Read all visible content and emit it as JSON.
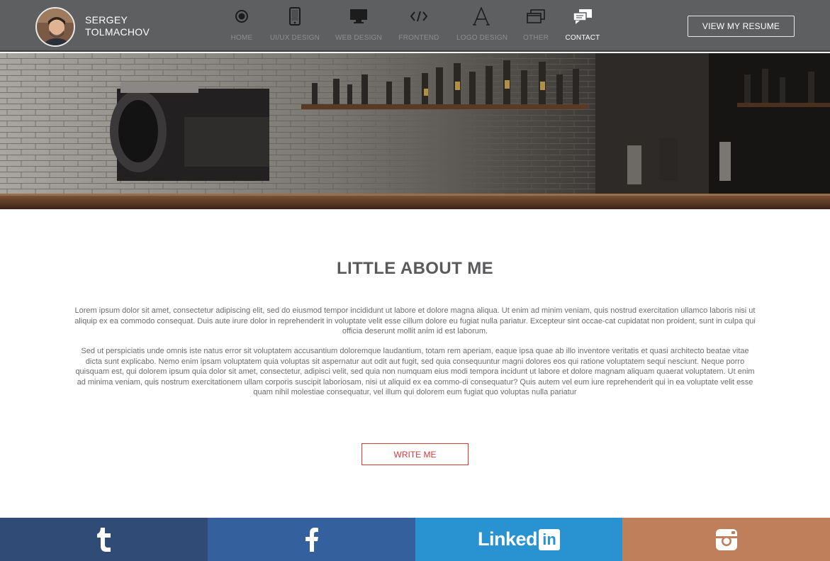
{
  "header": {
    "name_line1": "SERGEY",
    "name_line2": "TOLMACHOV",
    "resume_label": "VIEW MY RESUME",
    "nav": [
      {
        "label": "HOME",
        "icon": "target-icon"
      },
      {
        "label": "UI/UX DESIGN",
        "icon": "mobile-phone-icon"
      },
      {
        "label": "WEB DESIGN",
        "icon": "monitor-icon"
      },
      {
        "label": "FRONTEND",
        "icon": "code-icon"
      },
      {
        "label": "LOGO DESIGN",
        "icon": "letter-a-icon"
      },
      {
        "label": "OTHER",
        "icon": "windows-stack-icon"
      },
      {
        "label": "CONTACT",
        "icon": "chat-bubbles-icon",
        "active": true
      }
    ]
  },
  "about": {
    "title": "LITTLE ABOUT ME",
    "paragraph1": "Lorem ipsum dolor sit amet, consectetur adipiscing elit, sed do eiusmod tempor incididunt ut labore et dolore magna aliqua. Ut enim ad minim veniam, quis nostrud exercitation ullamco laboris nisi ut aliquip ex ea commodo consequat. Duis aute irure dolor in reprehenderit in voluptate velit esse cillum dolore eu fugiat nulla pariatur. Excepteur sint occae-cat cupidatat non proident, sunt in culpa qui officia deserunt mollit anim id est laborum.",
    "paragraph2": "Sed ut perspiciatis unde omnis iste natus error sit voluptatem accusantium doloremque laudantium, totam rem aperiam, eaque ipsa quae ab illo inventore veritatis et quasi architecto beatae vitae dicta sunt explicabo. Nemo enim ipsam voluptatem quia voluptas sit aspernatur aut odit aut fugit, sed quia consequuntur magni dolores eos qui ratione voluptatem sequi nesciunt. Neque porro quisquam est, qui dolorem ipsum quia dolor sit amet, consectetur, adipisci velit, sed quia non numquam eius modi tempora incidunt ut labore et dolore magnam aliquam quaerat voluptatem. Ut enim ad minima veniam, quis nostrum exercitationem ullam corporis suscipit laboriosam, nisi ut aliquid ex ea commo-di consequatur? Quis autem vel eum iure reprehenderit qui in ea voluptate velit esse quam nihil molestiae consequatur, vel illum qui dolorem eum fugiat quo voluptas nulla pariatur",
    "button_label": "WRITE ME"
  },
  "social": {
    "tumblr_glyph": "t",
    "facebook_glyph": "f",
    "linkedin_word": "Linked",
    "linkedin_box": "in",
    "colors": {
      "tumblr": "#304b75",
      "facebook": "#34609d",
      "linkedin": "#2993d2",
      "instagram": "#c07f5b"
    }
  },
  "colors": {
    "header_bg": "#5e5f61",
    "accent_red": "#d33a3a",
    "title_gray": "#5a5a5c"
  }
}
